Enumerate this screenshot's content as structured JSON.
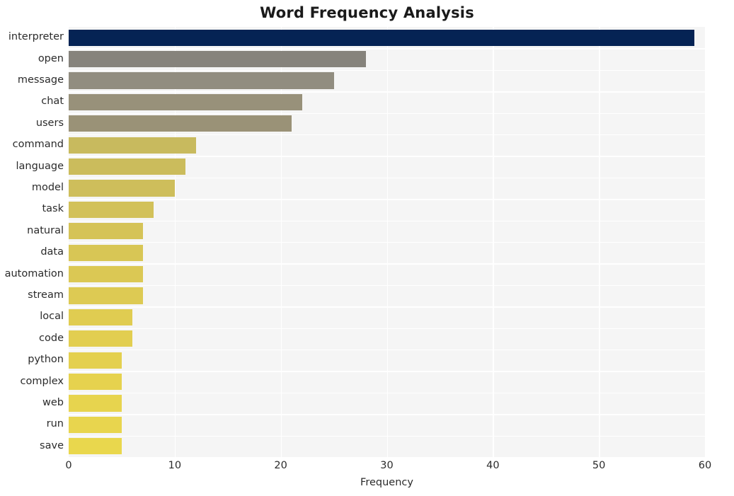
{
  "chart_data": {
    "type": "bar",
    "orientation": "horizontal",
    "title": "Word Frequency Analysis",
    "xlabel": "Frequency",
    "ylabel": "",
    "categories": [
      "interpreter",
      "open",
      "message",
      "chat",
      "users",
      "command",
      "language",
      "model",
      "task",
      "natural",
      "data",
      "automation",
      "stream",
      "local",
      "code",
      "python",
      "complex",
      "web",
      "run",
      "save"
    ],
    "values": [
      59,
      28,
      25,
      22,
      21,
      12,
      11,
      10,
      8,
      7,
      7,
      7,
      7,
      6,
      6,
      5,
      5,
      5,
      5,
      5
    ],
    "bar_colors": [
      "#052354",
      "#86837c",
      "#918d80",
      "#98917a",
      "#9a9277",
      "#c8ba5e",
      "#cbbc5c",
      "#cebe5b",
      "#d2c159",
      "#d5c357",
      "#d8c655",
      "#dbc854",
      "#ddca53",
      "#e0cc51",
      "#e2ce50",
      "#e4d04f",
      "#e6d24e",
      "#e7d44e",
      "#e8d54e",
      "#e9d74d"
    ],
    "xlim": [
      0,
      60
    ],
    "ylim": [
      0,
      20
    ],
    "xticks": [
      0,
      10,
      20,
      30,
      40,
      50,
      60
    ],
    "xtick_labels": [
      "0",
      "10",
      "20",
      "30",
      "40",
      "50",
      "60"
    ],
    "grid": true,
    "grid_axis": "x",
    "grid_color": "#ffffff",
    "legend": false,
    "plot_background": "#f5f5f5",
    "figure_background": "#ffffff",
    "text_color": "#2b2b2b",
    "title_color": "#1a1a1a"
  }
}
